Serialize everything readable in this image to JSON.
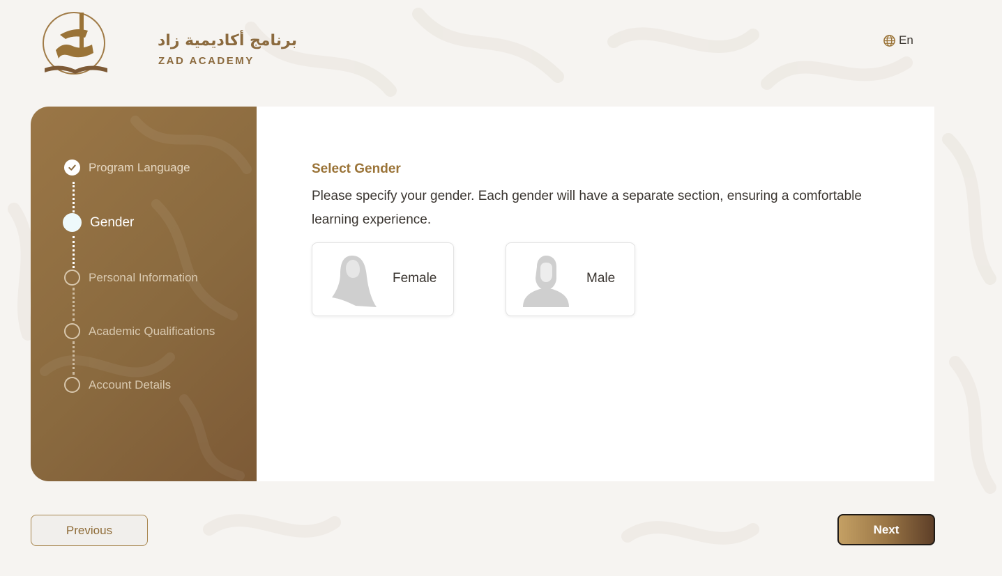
{
  "header": {
    "logo_arabic": "برنامج أكاديمية زاد",
    "logo_english": "ZAD ACADEMY",
    "language_label": "En"
  },
  "steps": [
    {
      "label": "Program Language",
      "state": "done"
    },
    {
      "label": "Gender",
      "state": "active"
    },
    {
      "label": "Personal Information",
      "state": "pending"
    },
    {
      "label": "Academic Qualifications",
      "state": "pending"
    },
    {
      "label": "Account Details",
      "state": "pending"
    }
  ],
  "main": {
    "title": "Select Gender",
    "description": "Please specify your gender. Each gender will have a separate section, ensuring a comfortable learning experience.",
    "options": [
      {
        "label": "Female",
        "icon": "female-avatar-icon"
      },
      {
        "label": "Male",
        "icon": "male-avatar-icon"
      }
    ]
  },
  "footer": {
    "previous_label": "Previous",
    "next_label": "Next"
  },
  "colors": {
    "accent": "#9a7337",
    "sidebar": "#8a6a3f",
    "background": "#f6f4f1"
  }
}
